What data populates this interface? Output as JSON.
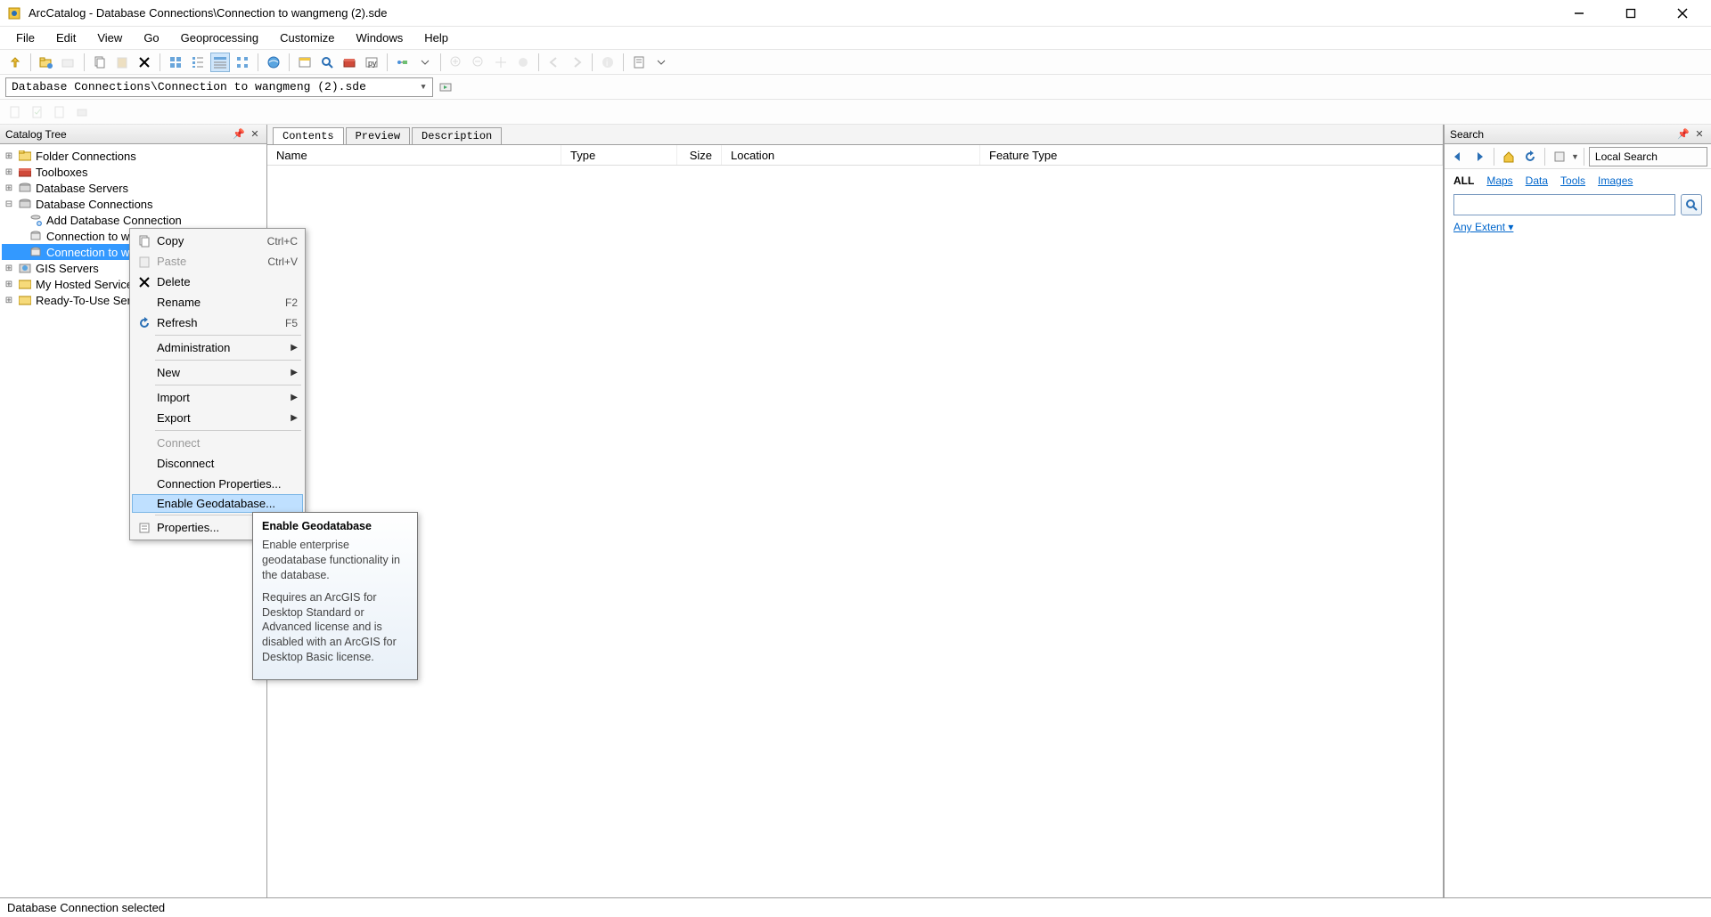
{
  "window": {
    "title": "ArcCatalog - Database Connections\\Connection to wangmeng (2).sde"
  },
  "menu": {
    "items": [
      "File",
      "Edit",
      "View",
      "Go",
      "Geoprocessing",
      "Customize",
      "Windows",
      "Help"
    ]
  },
  "address": {
    "path": "Database Connections\\Connection to wangmeng (2).sde"
  },
  "catalog": {
    "title": "Catalog Tree",
    "nodes": {
      "folder_connections": "Folder Connections",
      "toolboxes": "Toolboxes",
      "database_servers": "Database Servers",
      "database_connections": "Database Connections",
      "add_db_conn": "Add Database Connection",
      "conn_wangmeng": "Connection to wangmeng.sde",
      "conn_wangmeng2": "Connection to wangmeng (2).sde",
      "gis_servers": "GIS Servers",
      "my_hosted": "My Hosted Services",
      "ready_to_use": "Ready-To-Use Services"
    }
  },
  "content": {
    "tabs": {
      "contents": "Contents",
      "preview": "Preview",
      "description": "Description"
    },
    "columns": {
      "name": "Name",
      "type": "Type",
      "size": "Size",
      "location": "Location",
      "feature_type": "Feature Type"
    }
  },
  "context_menu": {
    "copy": "Copy",
    "copy_sc": "Ctrl+C",
    "paste": "Paste",
    "paste_sc": "Ctrl+V",
    "delete": "Delete",
    "rename": "Rename",
    "rename_sc": "F2",
    "refresh": "Refresh",
    "refresh_sc": "F5",
    "administration": "Administration",
    "new": "New",
    "import": "Import",
    "export": "Export",
    "connect": "Connect",
    "disconnect": "Disconnect",
    "conn_props": "Connection Properties...",
    "enable_gdb": "Enable Geodatabase...",
    "properties": "Properties..."
  },
  "tooltip": {
    "title": "Enable Geodatabase",
    "p1": "Enable enterprise geodatabase functionality in the database.",
    "p2": "Requires an ArcGIS for Desktop Standard or Advanced license and is disabled with an ArcGIS for Desktop Basic license."
  },
  "search": {
    "title": "Search",
    "combo": "Local Search",
    "tabs": {
      "all": "ALL",
      "maps": "Maps",
      "data": "Data",
      "tools": "Tools",
      "images": "Images"
    },
    "placeholder": "",
    "extent": "Any Extent"
  },
  "status": {
    "text": "Database Connection selected"
  }
}
